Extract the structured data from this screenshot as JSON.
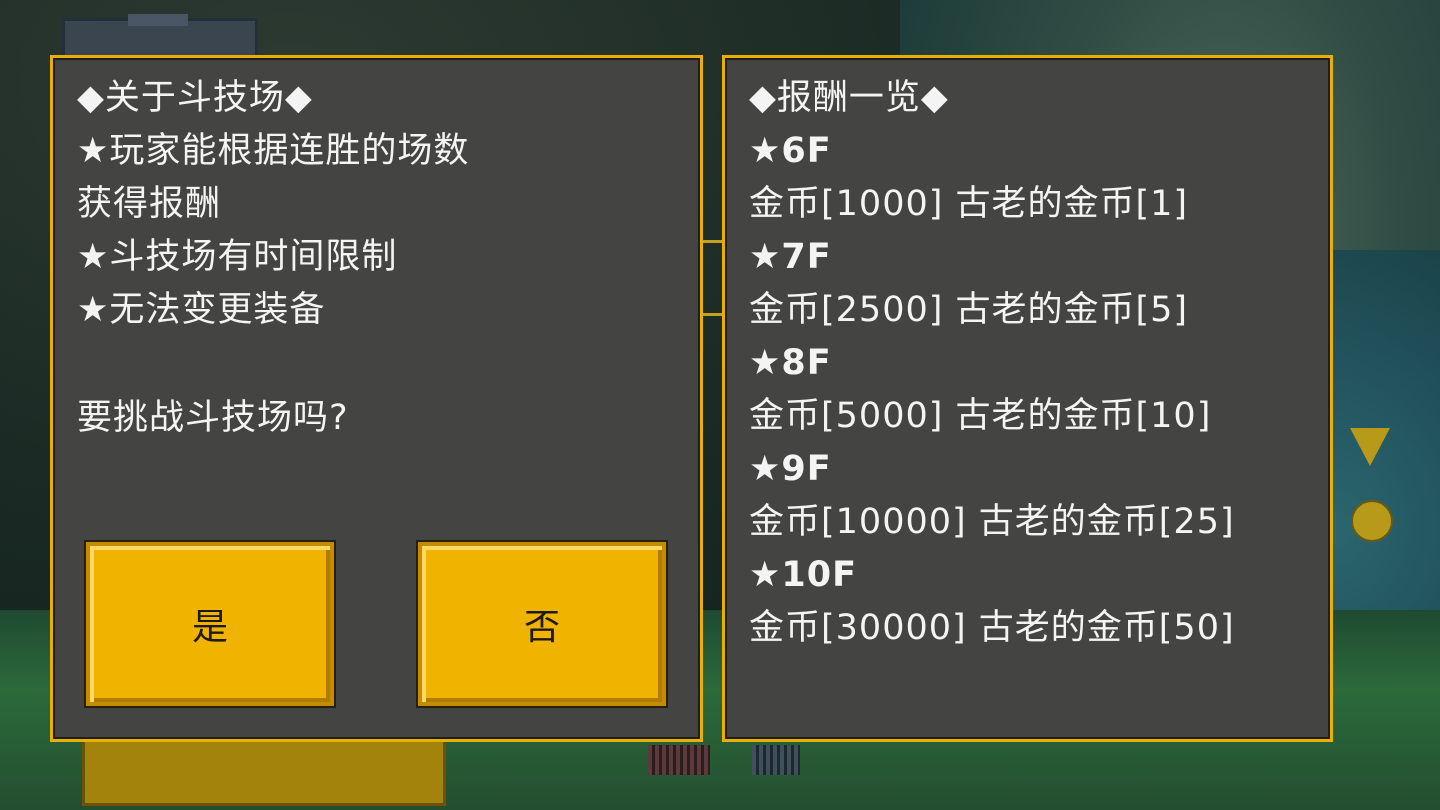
{
  "left_panel": {
    "title": "◆关于斗技场◆",
    "rule_1a": "★玩家能根据连胜的场数",
    "rule_1b": "获得报酬",
    "rule_2": "★斗技场有时间限制",
    "rule_3": "★无法变更装备",
    "question": "要挑战斗技场吗?",
    "yes_label": "是",
    "no_label": "否"
  },
  "right_panel": {
    "title": "◆报酬一览◆",
    "rewards": [
      {
        "floor": "★6F",
        "line": "金币[1000] 古老的金币[1]"
      },
      {
        "floor": "★7F",
        "line": "金币[2500] 古老的金币[5]"
      },
      {
        "floor": "★8F",
        "line": "金币[5000] 古老的金币[10]"
      },
      {
        "floor": "★9F",
        "line": "金币[10000] 古老的金币[25]"
      },
      {
        "floor": "★10F",
        "line": "金币[30000] 古老的金币[50]"
      }
    ]
  },
  "colors": {
    "panel_bg": "#444542",
    "panel_border": "#e8b000",
    "button_bg": "#f0b300",
    "text": "#f4f4f4"
  }
}
